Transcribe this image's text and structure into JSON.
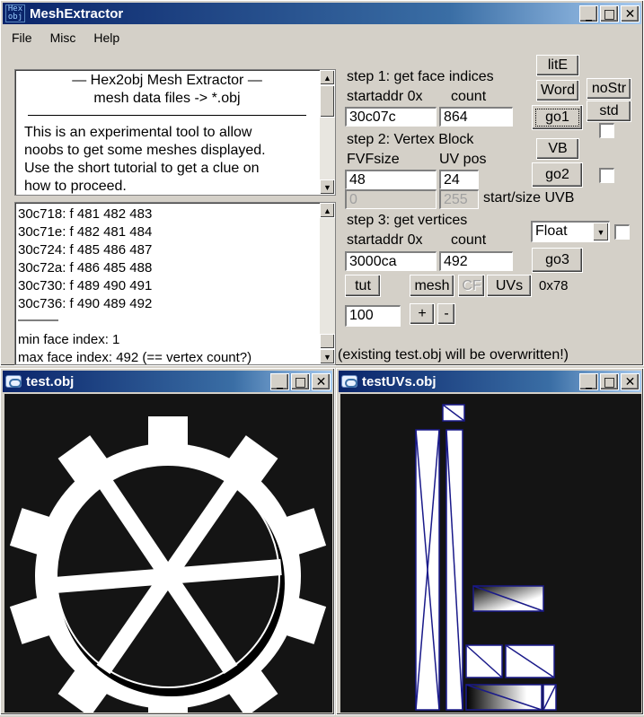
{
  "main_window": {
    "title": "MeshExtractor",
    "icon_text": "Hex obj",
    "minimize": "_",
    "maximize": "□",
    "close": "✕"
  },
  "menu": [
    "File",
    "Misc",
    "Help"
  ],
  "info_box": {
    "title": "—   Hex2obj Mesh Extractor   —",
    "subtitle": "mesh data files -> *.obj",
    "lines": [
      "This is an experimental tool to allow",
      "noobs to get some meshes displayed.",
      "Use the short tutorial to get a clue on",
      "how to proceed."
    ]
  },
  "output_list": {
    "lines": [
      "30c718: f  481 482 483",
      "30c71e: f  482 481 484",
      "30c724: f  485 486 487",
      "30c72a: f  486 485 488",
      "30c730: f  489 490 491",
      "30c736: f  490 489 492"
    ],
    "separator": "———",
    "min_line": "min face index: 1",
    "max_line": "max face index: 492 (== vertex count?)"
  },
  "step1": {
    "heading": "step 1: get face indices",
    "startaddr_label": "startaddr 0x",
    "count_label": "count",
    "startaddr": "30c07c",
    "count": "864"
  },
  "step2": {
    "heading": "step 2: Vertex Block",
    "fvf_label": "FVFsize",
    "uvpos_label": "UV pos",
    "fvf": "48",
    "uvpos": "24",
    "uv_start": "0",
    "uv_size": "255",
    "uvb_label": "start/size UVB"
  },
  "step3": {
    "heading": "step 3: get vertices",
    "startaddr_label": "startaddr 0x",
    "count_label": "count",
    "startaddr": "3000ca",
    "count": "492",
    "format": "Float"
  },
  "buttons": {
    "lite": "litE",
    "word": "Word",
    "nostr": "noStr",
    "go1": "go1",
    "std": "std",
    "vb": "VB",
    "go2": "go2",
    "go3": "go3",
    "tut": "tut",
    "mesh": "mesh",
    "cf": "CF",
    "uvs": "UVs",
    "plus": "+",
    "minus": "-"
  },
  "hex_readout": "0x78",
  "scale_value": "100",
  "overwrite_note": "(existing test.obj will be overwritten!)",
  "mesh_window": {
    "title": "test.obj"
  },
  "uv_window": {
    "title": "testUVs.obj"
  }
}
